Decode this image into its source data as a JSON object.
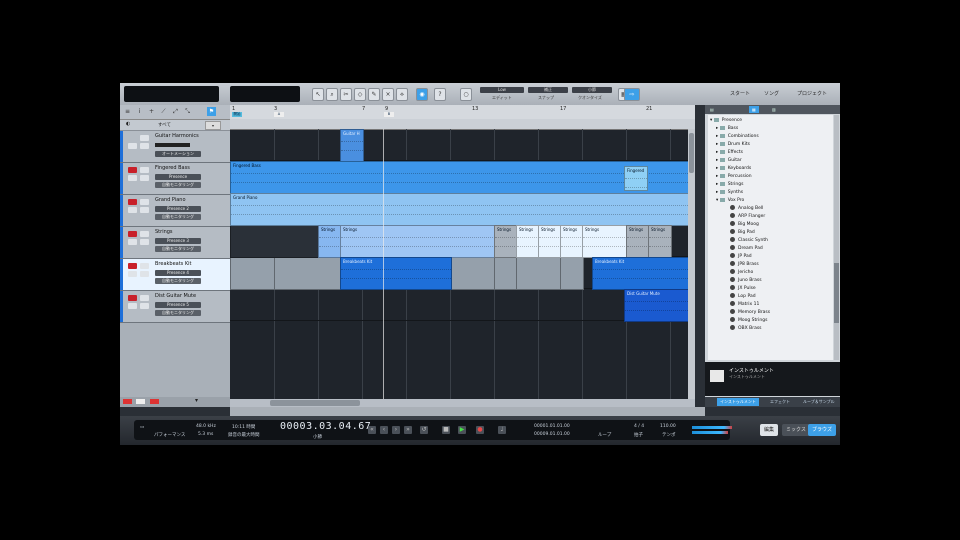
{
  "toolbar": {
    "mode_labels": [
      "Low",
      "補正",
      "小節"
    ],
    "mode_sub": [
      "エディット",
      "スナップ",
      "クオンタイズ"
    ],
    "start_label": "スタート",
    "song_label": "ソング",
    "project_label": "プロジェクト"
  },
  "trackcol": {
    "search_label": "すべて",
    "tracks": [
      {
        "name": "Guitar Harmonics",
        "inst": "オートメーション",
        "color": "#1e6fd9",
        "selected": false
      },
      {
        "name": "Fingered Bass",
        "inst": "Presence",
        "sub": "自動モニタリング",
        "color": "#1e6fd9",
        "selected": false
      },
      {
        "name": "Grand Piano",
        "inst": "Presence 2",
        "sub": "自動モニタリング",
        "color": "#1e6fd9",
        "selected": false
      },
      {
        "name": "Strings",
        "inst": "Presence 3",
        "sub": "自動モニタリング",
        "color": "#1e6fd9",
        "selected": false
      },
      {
        "name": "Breakbeats Kit",
        "inst": "Presence 4",
        "sub": "自動モニタリング",
        "color": "#1e6fd9",
        "selected": true
      },
      {
        "name": "Dist Guitar Mute",
        "inst": "Presence 5",
        "sub": "自動モニタリング",
        "color": "#1e6fd9",
        "selected": false
      }
    ]
  },
  "arrange": {
    "ruler": [
      "1",
      "3",
      "7",
      "9",
      "13",
      "17",
      "21"
    ],
    "markers": [
      "開始",
      "A",
      "B"
    ],
    "clips": [
      {
        "lane": 0,
        "label": "Guitar H",
        "color": "#4a8fe0",
        "dark": true
      },
      {
        "lane": 1,
        "label": "Fingered Bass",
        "color": "#3d96ea",
        "dark": false
      },
      {
        "lane": 1,
        "label": "Fingered",
        "color": "#8fd0f5",
        "dark": false
      },
      {
        "lane": 2,
        "label": "Grand Piano",
        "color": "#8fc4f2",
        "dark": false
      },
      {
        "lane": 3,
        "label": "Strings",
        "color": "#87b7f0",
        "dark": false
      },
      {
        "lane": 3,
        "label": "Strings",
        "color": "#9fc6f4",
        "dark": false
      },
      {
        "lane": 3,
        "label": "Strings",
        "color": "#a9b2bc",
        "dark": false
      },
      {
        "lane": 3,
        "label": "Strings",
        "color": "#e8f4ff",
        "dark": false
      },
      {
        "lane": 3,
        "label": "Strings",
        "color": "#e8f4ff",
        "dark": false
      },
      {
        "lane": 3,
        "label": "Strings",
        "color": "#e8f4ff",
        "dark": false
      },
      {
        "lane": 3,
        "label": "Strings",
        "color": "#e8f4ff",
        "dark": false
      },
      {
        "lane": 3,
        "label": "Strings",
        "color": "#a9b2bc",
        "dark": false
      },
      {
        "lane": 3,
        "label": "Strings",
        "color": "#a9b2bc",
        "dark": false
      },
      {
        "lane": 4,
        "label": "Breakbeats Kit",
        "color": "#1e6fd9",
        "dark": true
      },
      {
        "lane": 4,
        "label": "Breakbeats Kit",
        "color": "#1e6fd9",
        "dark": true
      },
      {
        "lane": 5,
        "label": "Dist Guitar Mute",
        "color": "#1a5ad0",
        "dark": true
      }
    ]
  },
  "browser": {
    "tabs": [
      "インストゥルメント",
      "エフェクト",
      "サウンド"
    ],
    "folder": "Presence",
    "categories": [
      "Bass",
      "Combinations",
      "Drum Kits",
      "Effects",
      "Guitar",
      "Keyboards",
      "Percussion",
      "Strings",
      "Synths",
      "Vox Pro"
    ],
    "presets": [
      "Analog Bell",
      "ARP Flanger",
      "Big Moog",
      "Big Pad",
      "Classic Synth",
      "Dream Pad",
      "JP Pad",
      "JP8 Brass",
      "Jericho",
      "Juno Brass",
      "JX Pulse",
      "Lop Pad",
      "Matrix 11",
      "Memory Brass",
      "Moog Strings",
      "OBX Brass"
    ],
    "info_title": "インストゥルメント",
    "info_sub": "インストゥルメント",
    "footer_tabs": [
      "インストゥルメント",
      "エフェクト",
      "ループ＆サンプル"
    ]
  },
  "transport": {
    "cpu_label": "パフォーマンス",
    "sample_rate": "48.0 kHz",
    "latency": "5.3 ms",
    "record_time": "10:11 時間",
    "record_label": "録音の最大時間",
    "time_display": "00003.03.04.67",
    "time_unit": "小節",
    "loop_start": "00001.01.01.00",
    "loop_end": "00009.01.01.00",
    "loop_label": "ループ",
    "signature": "4 / 4",
    "signature_label": "拍子",
    "tempo": "110.00",
    "tempo_label": "テンポ",
    "buttons": [
      "編集",
      "ミックス",
      "ブラウズ"
    ]
  },
  "colors": {
    "accent": "#3da0e8",
    "track_blue": "#1e6fd9"
  }
}
